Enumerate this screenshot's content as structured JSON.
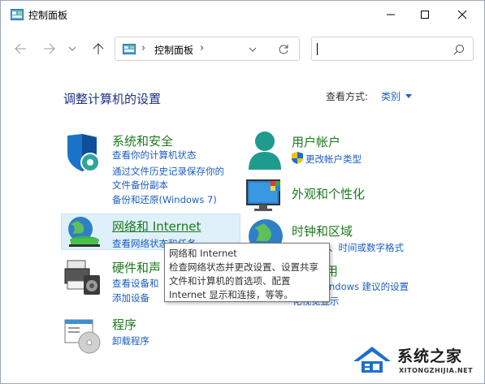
{
  "window": {
    "title": "控制面板"
  },
  "address": {
    "crumb": "控制面板",
    "sep1": "›",
    "sep2": "›"
  },
  "search": {
    "placeholder": ""
  },
  "content": {
    "heading": "调整计算机的设置",
    "view_by_label": "查看方式:",
    "view_by_value": "类别"
  },
  "categories": [
    {
      "title": "系统和安全",
      "icon": "shield-icon",
      "links": [
        "查看你的计算机状态",
        "通过文件历史记录保存你的",
        "文件备份副本",
        "备份和还原(Windows 7)"
      ]
    },
    {
      "title": "网络和 Internet",
      "icon": "globe-network-icon",
      "links": [
        "查看网络状态和任务"
      ]
    },
    {
      "title": "硬件和声",
      "icon": "printer-speaker-icon",
      "links": [
        "查看设备和",
        "添加设备"
      ]
    },
    {
      "title": "程序",
      "icon": "programs-icon",
      "links": [
        "卸载程序"
      ]
    },
    {
      "title": "用户帐户",
      "icon": "user-icon",
      "links": [
        "更改帐户类型"
      ]
    },
    {
      "title": "外观和个性化",
      "icon": "appearance-icon",
      "links": []
    },
    {
      "title": "时钟和区域",
      "icon": "clock-globe-icon",
      "links": [
        "更改日期、时间或数字格式"
      ]
    },
    {
      "title": "用",
      "icon": "ease-of-access-icon",
      "links": [
        "ndows 建议的设置",
        "化视觉显示"
      ]
    }
  ],
  "tooltip": {
    "lines": [
      "网络和 Internet",
      "检查网络状态并更改设置、设置共享",
      "文件和计算机的首选项、配置",
      "Internet 显示和连接，等等。"
    ]
  },
  "watermark": {
    "brand": "系统之家",
    "url": "XITONGZHIJIA.NET"
  },
  "colors": {
    "heading": "#1e3287",
    "category_title": "#1c7a1c",
    "link": "#1c5ec2"
  }
}
